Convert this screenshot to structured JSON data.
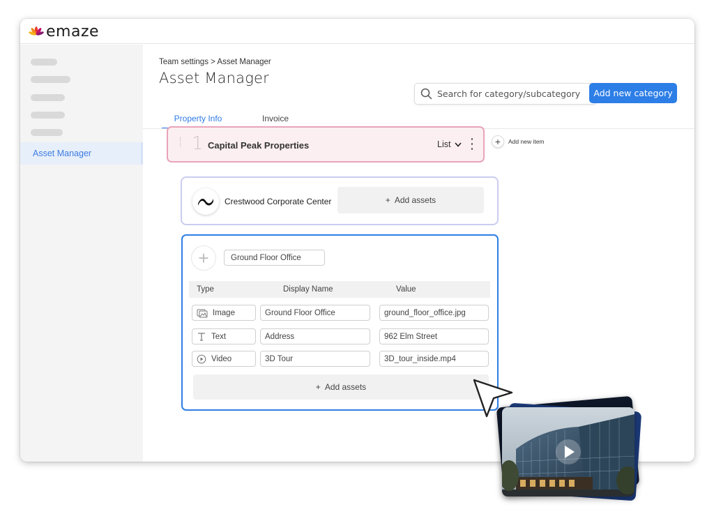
{
  "app": {
    "brand": "emaze"
  },
  "sidebar": {
    "active_item": "Asset Manager"
  },
  "header": {
    "breadcrumb": "Team settings > Asset Manager",
    "title": "Asset Manager",
    "search_placeholder": "Search for category/subcategory",
    "add_category_label": "Add new category"
  },
  "tabs": [
    {
      "label": "Property Info",
      "active": true
    },
    {
      "label": "Invoice",
      "active": false
    }
  ],
  "category": {
    "number": "1",
    "name": "Capital Peak Properties",
    "type": "List",
    "add_item_label": "Add new item"
  },
  "subcategory": {
    "name": "Crestwood Corporate Center",
    "add_assets_label": "Add assets"
  },
  "asset_group": {
    "name": "Ground Floor Office",
    "columns": [
      "Type",
      "Display Name",
      "Value"
    ],
    "rows": [
      {
        "type": "Image",
        "icon": "image-icon",
        "display_name": "Ground Floor Office",
        "value": "ground_floor_office.jpg"
      },
      {
        "type": "Text",
        "icon": "text-icon",
        "display_name": "Address",
        "value": "962 Elm Street"
      },
      {
        "type": "Video",
        "icon": "video-icon",
        "display_name": "3D Tour",
        "value": "3D_tour_inside.mp4"
      }
    ],
    "add_assets_label": "Add assets"
  },
  "colors": {
    "accent": "#2d7ee6",
    "category_border": "#e9a3ba",
    "category_bg": "#fbeff1",
    "subcategory_border": "#c9cdf0"
  }
}
